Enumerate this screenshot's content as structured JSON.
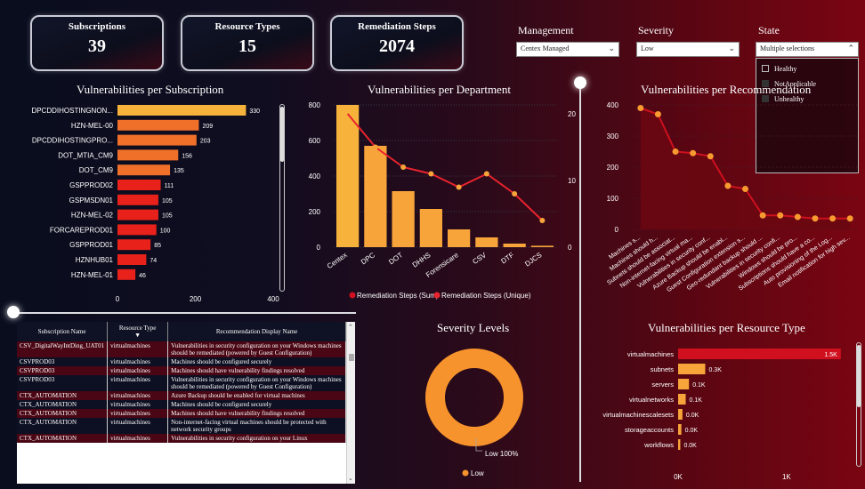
{
  "kpis": [
    {
      "label": "Subscriptions",
      "value": "39"
    },
    {
      "label": "Resource Types",
      "value": "15"
    },
    {
      "label": "Remediation Steps",
      "value": "2074"
    }
  ],
  "slicers": {
    "management": {
      "label": "Management",
      "value": "Centex Managed"
    },
    "severity": {
      "label": "Severity",
      "value": "Low"
    },
    "state": {
      "label": "State",
      "value": "Multiple selections",
      "options": [
        "Healthy",
        "NotApplicable",
        "Unhealthy"
      ]
    }
  },
  "titles": {
    "sub": "Vulnerabilities per Subscription",
    "dept": "Vulnerabilities per Department",
    "rec": "Vulnerabilities per Recommendation",
    "sev": "Severity Levels",
    "res": "Vulnerabilities per Resource Type"
  },
  "table": {
    "headers": [
      "Subscription Name",
      "Resource Type",
      "Recommendation Display Name"
    ],
    "rows": [
      {
        "sub": "CSV_DigitalWayIntDing_UAT01",
        "type": "virtualmachines",
        "rec": "Vulnerabilities in security configuration on your Windows machines should be remediated (powered by Guest Configuration)",
        "style": "red"
      },
      {
        "sub": "CSVPROD03",
        "type": "virtualmachines",
        "rec": "Machines should be configured securely",
        "style": "dark"
      },
      {
        "sub": "CSVPROD03",
        "type": "virtualmachines",
        "rec": "Machines should have vulnerability findings resolved",
        "style": "red"
      },
      {
        "sub": "CSVPROD03",
        "type": "virtualmachines",
        "rec": "Vulnerabilities in security configuration on your Windows machines should be remediated (powered by Guest Configuration)",
        "style": "dark"
      },
      {
        "sub": "CTX_AUTOMATION",
        "type": "virtualmachines",
        "rec": "Azure Backup should be enabled for virtual machines",
        "style": "red"
      },
      {
        "sub": "CTX_AUTOMATION",
        "type": "virtualmachines",
        "rec": "Machines should be configured securely",
        "style": "dark"
      },
      {
        "sub": "CTX_AUTOMATION",
        "type": "virtualmachines",
        "rec": "Machines should have vulnerability findings resolved",
        "style": "red"
      },
      {
        "sub": "CTX_AUTOMATION",
        "type": "virtualmachines",
        "rec": "Non-internet-facing virtual machines should be protected with network security groups",
        "style": "dark"
      },
      {
        "sub": "CTX_AUTOMATION",
        "type": "virtualmachines",
        "rec": "Vulnerabilities in security configuration on your Linux",
        "style": "red"
      }
    ]
  },
  "chart_data": [
    {
      "type": "bar",
      "orientation": "horizontal",
      "title": "Vulnerabilities per Subscription",
      "categories": [
        "DPCDDIHOSTINGNON...",
        "HZN-MEL-00",
        "DPCDDIHOSTINGPRO...",
        "DOT_MTIA_CM9",
        "DOT_CM9",
        "GSPPROD02",
        "GSPMSDN01",
        "HZN-MEL-02",
        "FORCAREPROD01",
        "GSPPROD01",
        "HZNHUB01",
        "HZN-MEL-01"
      ],
      "values": [
        330,
        209,
        203,
        156,
        135,
        111,
        105,
        105,
        100,
        85,
        74,
        46
      ],
      "xticks": [
        "0",
        "200",
        "400"
      ],
      "xlim": [
        0,
        400
      ],
      "colors": {
        "top": "#f7b23b",
        "high": "#f0702a",
        "low": "#e8211a"
      }
    },
    {
      "type": "bar",
      "title": "Vulnerabilities per Department",
      "categories": [
        "Centex",
        "DPC",
        "DOT",
        "DHHS",
        "Forensicare",
        "CSV",
        "DTF",
        "DJCS"
      ],
      "values": [
        800,
        570,
        315,
        215,
        100,
        55,
        20,
        8
      ],
      "ylim": [
        0,
        800
      ],
      "yticks": [
        "0",
        "200",
        "400",
        "600",
        "800"
      ],
      "y2ticks": [
        "0",
        "10",
        "20"
      ],
      "y2lim": [
        0,
        20
      ],
      "series": [
        {
          "name": "Remediation Steps (Sum)",
          "color": "#d0101e"
        },
        {
          "name": "Remediation Steps (Unique)",
          "color": "#e8232e",
          "values": [
            20,
            15,
            12,
            11,
            9,
            11,
            8,
            4
          ]
        }
      ],
      "bar_colors": {
        "top": "#f7b23b",
        "rest": "#f7a53a"
      }
    },
    {
      "type": "area",
      "title": "Vulnerabilities per Recommendation",
      "categories": [
        "Machines s...",
        "Machines should h...",
        "Subnets should be associat...",
        "Non-internet-facing virtual ma...",
        "Vulnerabilities in security conf...",
        "Azure Backup should be enabl...",
        "Guest Configuration extension s...",
        "Geo-redundant backup should ...",
        "Vulnerabilities in security confi...",
        "Windows should be pro...",
        "Subscriptions should have a co...",
        "Auto provisioning of the Log...",
        "Email notification for high sev..."
      ],
      "values": [
        390,
        370,
        250,
        245,
        235,
        140,
        130,
        45,
        45,
        40,
        35,
        35,
        35
      ],
      "ylim": [
        0,
        400
      ],
      "yticks": [
        "0",
        "100",
        "200",
        "300",
        "400"
      ],
      "colors": {
        "line": "#d0101e",
        "point": "#f79a30",
        "fill": "#6a0812"
      }
    },
    {
      "type": "pie",
      "title": "Severity Levels",
      "slices": [
        {
          "name": "Low",
          "value": 100,
          "label": "Low 100%",
          "color": "#f7932c"
        }
      ]
    },
    {
      "type": "bar",
      "orientation": "horizontal",
      "title": "Vulnerabilities per Resource Type",
      "categories": [
        "virtualmachines",
        "subnets",
        "servers",
        "virtualnetworks",
        "virtualmachinescalesets",
        "storageaccounts",
        "workflows"
      ],
      "values": [
        1500,
        250,
        100,
        70,
        40,
        30,
        20
      ],
      "labels": [
        "1.5K",
        "0.3K",
        "0.1K",
        "0.1K",
        "0.0K",
        "0.0K",
        "0.0K"
      ],
      "xlim": [
        0,
        1600
      ],
      "xticks": [
        "0K",
        "1K"
      ],
      "colors": {
        "first": "#d0101e",
        "rest": "#f7a53a"
      }
    }
  ]
}
